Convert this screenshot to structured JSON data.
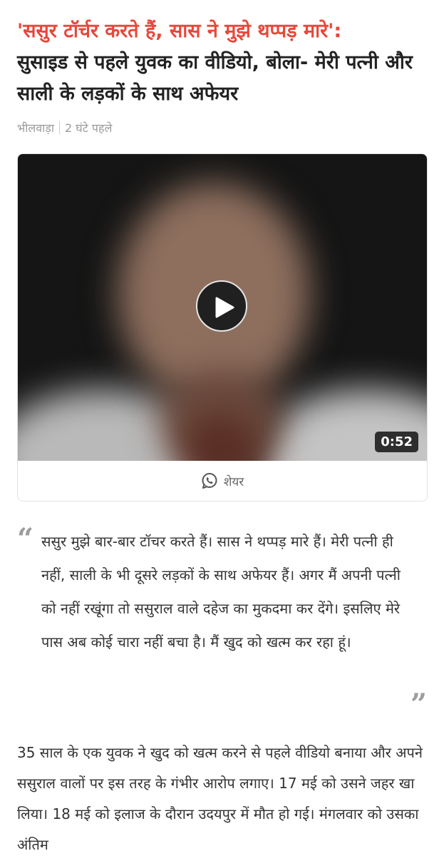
{
  "article": {
    "kicker": "'ससुर टॉर्चर करते हैं, सास ने मुझे थप्पड़ मारे':",
    "title": "सुसाइड से पहले युवक का वीडियो, बोला- मेरी पत्नी और साली के लड़कों के साथ अफेयर",
    "location": "भीलवाड़ा",
    "time_ago": "2 घंटे पहले"
  },
  "video": {
    "duration": "0:52",
    "share_label": "शेयर"
  },
  "quote": {
    "text": "ससुर मुझे बार-बार टॉचर करते हैं। सास ने थप्पड़ मारे हैं। मेरी पत्नी ही नहीं, साली के भी दूसरे लड़कों के साथ अफेयर हैं। अगर मैं अपनी पत्नी को नहीं रखूंगा तो ससुराल वाले दहेज का मुकदमा कर देंगे। इसलिए मेरे पास अब कोई चारा नहीं बचा है। मैं खुद को खत्म कर रहा हूं।",
    "open_mark": "“",
    "close_mark": "”"
  },
  "body": {
    "paragraph": "35 साल के एक युवक ने खुद को खत्म करने से पहले वीडियो बनाया और अपने ससुराल वालों पर इस तरह के गंभीर आरोप लगाए। 17 मई को उसने जहर खा लिया। 18 मई को इलाज के दौरान उदयपुर में मौत हो गई। मंगलवार को उसका अंतिम"
  },
  "colors": {
    "kicker": "#e8473a",
    "meta": "#9a9a9a",
    "whatsapp_icon": "#555555"
  },
  "icons": {
    "play": "play-icon",
    "share": "whatsapp-icon",
    "quote_open": "quote-open-icon",
    "quote_close": "quote-close-icon"
  }
}
